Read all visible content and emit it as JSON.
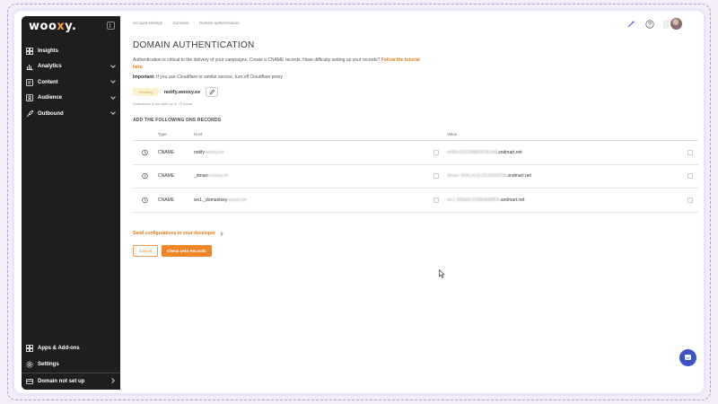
{
  "brand": {
    "logo_prefix": "woo",
    "logo_x": "x",
    "logo_suffix": "y.",
    "accent": "#ee8527",
    "sidebar_bg": "#1e1e1e"
  },
  "sidebar": {
    "items": [
      {
        "label": "Insights",
        "icon": "grid-icon",
        "expandable": false
      },
      {
        "label": "Analytics",
        "icon": "chart-icon",
        "expandable": true
      },
      {
        "label": "Content",
        "icon": "content-icon",
        "expandable": true
      },
      {
        "label": "Audience",
        "icon": "audience-icon",
        "expandable": true
      },
      {
        "label": "Outbound",
        "icon": "rocket-icon",
        "expandable": true
      }
    ],
    "bottom": [
      {
        "label": "Apps & Add-ons",
        "icon": "apps-icon"
      },
      {
        "label": "Settings",
        "icon": "gear-icon"
      },
      {
        "label": "Domain not set up",
        "icon": "domain-icon"
      }
    ]
  },
  "breadcrumb": [
    "Account settings",
    "Domains",
    "Domain authentication"
  ],
  "page": {
    "title": "DOMAIN AUTHENTICATION",
    "description": "Authentication is critical to the delivery of your campaigns. Create a CNAME records. Have difficulty setting up your records?",
    "description_link": "Follow the tutorial here",
    "important_label": "Important:",
    "important_text": "If you use Cloudflare or similar service, turn off Cloudflare proxy",
    "status_badge": "Pending",
    "domain": "notify.wooxy.ee",
    "hint": "Sometimes it can take up to 72 hours",
    "section_title": "ADD THE FOLLOWING DNS RECORDS"
  },
  "dns": {
    "headers": {
      "type": "Type",
      "host": "Host",
      "value": "Value"
    },
    "rows": [
      {
        "type": "CNAME",
        "host": "notify",
        "host_blur": ".wooxy.ee",
        "value_blur": "wNl6vEl1Ol9t8kl0f2lEnhtl",
        "value": ".sndmart.net"
      },
      {
        "type": "CNAME",
        "host": "_dmarc",
        "host_blur": ".wooxy.ee",
        "value_blur": "dmarc.4l9kl.ex1b18c8d8bf93ll",
        "value": ".sndmart.net"
      },
      {
        "type": "CNAME",
        "host": "wx1._domainkey",
        "host_blur": ".wooxy.ee",
        "value_blur": "wx1.96fbb8c1f0f8b8d9ff0d",
        "value": ".sndmart.net"
      }
    ]
  },
  "share_link": "Send configurations to your developer",
  "buttons": {
    "cancel": "Cancel",
    "check": "Check DNS Records"
  }
}
